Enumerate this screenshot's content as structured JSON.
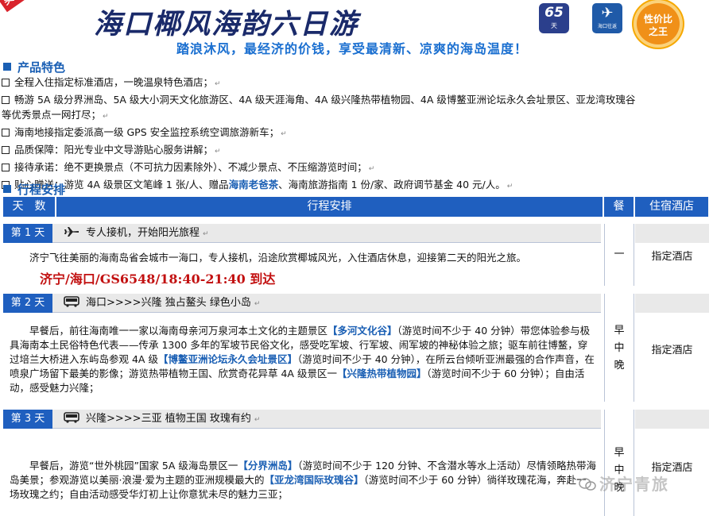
{
  "header": {
    "ribbon_text": "买下",
    "title": "海口椰风海韵六日游",
    "subtitle": "踏浪沐风，最经济的价钱，享受最清新、凉爽的海岛温度！",
    "badge_65_num": "65",
    "badge_65_unit": "天",
    "badge_hk_text": "海口往返",
    "badge_value_line1": "性价比",
    "badge_value_line2": "之王"
  },
  "features": {
    "heading": "产品特色",
    "items": [
      "全程入住指定标准酒店，一晚温泉特色酒店；",
      "畅游 5A 级分界洲岛、5A 级大小洞天文化旅游区、4A 级天涯海角、4A 级兴隆热带植物园、4A 级博鳌亚洲论坛永久会址景区、亚龙湾玫瑰谷",
      "海南地接指定委派高一级 GPS 安全监控系统空调旅游新车；",
      "品质保障：阳光专业中文导游贴心服务讲解；",
      "接待承诺：绝不更换景点（不可抗力因素除外）、不减少景点、不压缩游览时间；"
    ],
    "item2_cont": "等优秀景点一网打尽；",
    "gift_prefix": "贴心赠送：游览 4A 级景区文笔峰 1 张/人、赠品",
    "gift_highlight": "海南老爸茶",
    "gift_suffix": "、海南旅游指南 1 份/家、政府调节基金 40 元/人。",
    "mark": "↵"
  },
  "schedule": {
    "heading": "行程安排",
    "columns": [
      "天　数",
      "行程安排",
      "餐",
      "住宿酒店"
    ],
    "days": [
      {
        "tag": "第 1 天",
        "title": "专人接机，开始阳光旅程",
        "icon": "airplane-icon",
        "body": "济宁飞往美丽的海南岛省会城市一海口，专人接机，沿途欣赏椰城风光，入住酒店休息，迎接第二天的阳光之旅。",
        "flight": "济宁/海口/GS6548/18:40-21:40 到达",
        "meal": "一",
        "hotel": "指定酒店"
      },
      {
        "tag": "第 2 天",
        "title": "海口>>>>兴隆  独占鳌头   绿色小岛",
        "icon": "bus-icon",
        "body_p1": "早餐后，前往海南唯一一家以海南母亲河万泉河本土文化的主题景区",
        "body_h1": "【多河文化谷】",
        "body_p2": "（游览时间不少于 40 分钟）带您体验参与极具海南本土民俗特色代表——传承 1300 多年的军坡节民俗文化，感受吃军坡、行军坡、闹军坡的神秘体验之旅；驱车前往博鳌，穿过培兰大桥进入东屿岛参观 4A 级",
        "body_h2": "【博鳌亚洲论坛永久会址景区】",
        "body_p3": "（游览时间不少于 40 分钟），在所云台倾听亚洲最强的合作声音，在喷泉广场留下最美的影像；游览热带植物王国、欣赏奇花异草 4A 级景区一",
        "body_h3": "【兴隆热带植物园】",
        "body_p4": "（游览时间不少于 60 分钟）；自由活动，感受魅力兴隆；",
        "meal": [
          "早",
          "中",
          "晚"
        ],
        "hotel": "指定酒店"
      },
      {
        "tag": "第 3 天",
        "title": "兴隆>>>>三亚   植物王国  玫瑰有约",
        "icon": "bus-icon",
        "body_p1": "早餐后，游览“世外桃园”国家 5A 级海岛景区一",
        "body_h1": "【分界洲岛】",
        "body_p2": "（游览时间不少于 120 分钟、不含潜水等水上活动）尽情领略热带海岛美景；参观游览以美丽·浪漫·爱为主题的亚洲规模最大的",
        "body_h2": "【亚龙湾国际玫瑰谷】",
        "body_p3": "（游览时间不少于 60 分钟）徜徉玫瑰花海，奔赴一场玫瑰之约；自由活动感受华灯初上让你意犹未尽的魅力三亚；",
        "meal": [
          "早",
          "中",
          "晚"
        ],
        "hotel": "指定酒店"
      }
    ]
  },
  "watermark": "济宁青旅",
  "colors": {
    "accent": "#1f5fbf",
    "flight": "#c21010",
    "title": "#1a2a6a"
  }
}
